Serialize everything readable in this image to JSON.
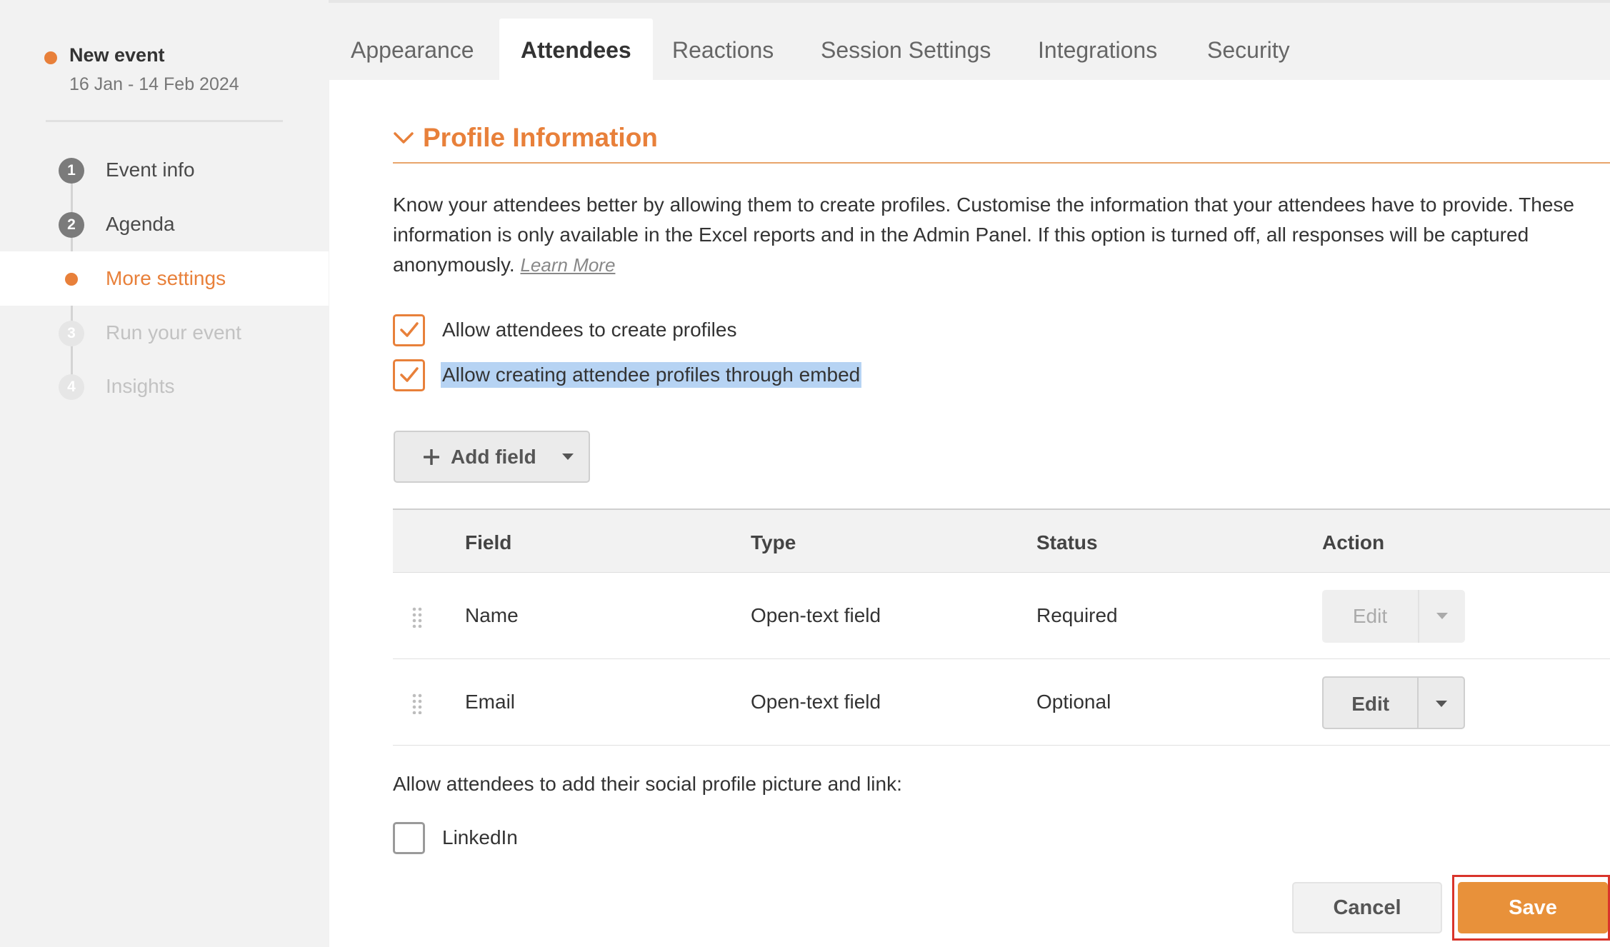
{
  "colors": {
    "accent": "#e8803a",
    "save_bg": "#e8913a",
    "highlight_red": "#d9342b",
    "selection": "#b6d3f3"
  },
  "sidebar": {
    "event": {
      "title": "New event",
      "dates": "16 Jan - 14 Feb 2024"
    },
    "steps": [
      {
        "number": "1",
        "label": "Event info"
      },
      {
        "number": "2",
        "label": "Agenda"
      },
      {
        "number": "",
        "label": "More settings"
      },
      {
        "number": "3",
        "label": "Run your event"
      },
      {
        "number": "4",
        "label": "Insights"
      }
    ]
  },
  "tabs": [
    {
      "label": "Appearance"
    },
    {
      "label": "Attendees"
    },
    {
      "label": "Reactions"
    },
    {
      "label": "Session Settings"
    },
    {
      "label": "Integrations"
    },
    {
      "label": "Security"
    }
  ],
  "section": {
    "title": "Profile Information",
    "description": "Know your attendees better by allowing them to create profiles. Customise the information that your attendees have to provide. These information is only available in the Excel reports and in the Admin Panel. If this option is turned off, all responses will be captured anonymously.",
    "learn_more": "Learn More"
  },
  "options": {
    "allow_profiles": {
      "label": "Allow attendees to create profiles",
      "checked": true
    },
    "allow_embed": {
      "label": "Allow creating attendee profiles through embed",
      "checked": true
    }
  },
  "add_field": {
    "label": "Add field"
  },
  "table": {
    "headers": {
      "field": "Field",
      "type": "Type",
      "status": "Status",
      "action": "Action"
    },
    "rows": [
      {
        "field": "Name",
        "type": "Open-text field",
        "status": "Required",
        "action": "Edit"
      },
      {
        "field": "Email",
        "type": "Open-text field",
        "status": "Optional",
        "action": "Edit"
      }
    ]
  },
  "social": {
    "prompt": "Allow attendees to add their social profile picture and link:",
    "linkedin": {
      "label": "LinkedIn",
      "checked": false
    }
  },
  "footer": {
    "cancel": "Cancel",
    "save": "Save"
  }
}
